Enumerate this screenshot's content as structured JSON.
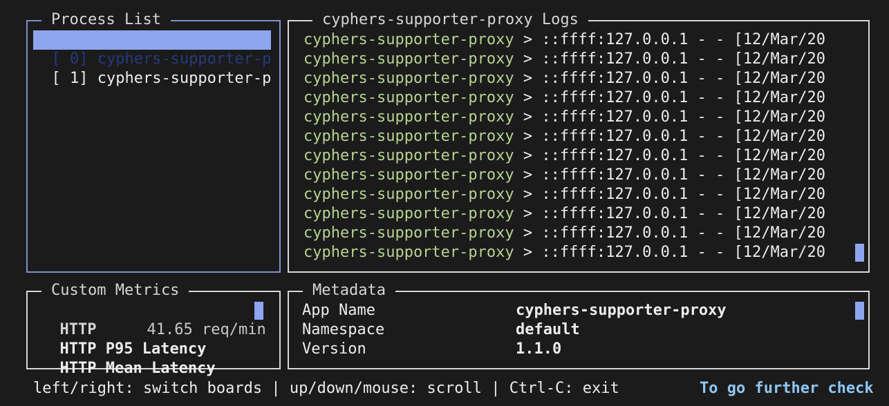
{
  "process_list": {
    "title": "Process List",
    "items": [
      {
        "label": "[ 0] cyphers-supporter-p",
        "selected": true
      },
      {
        "label": "[ 1] cyphers-supporter-p",
        "selected": false
      }
    ]
  },
  "logs": {
    "title": "cyphers-supporter-proxy Logs",
    "lines": [
      {
        "source": "cyphers-supporter-proxy",
        "message": " > ::ffff:127.0.0.1 - - [12/Mar/20"
      },
      {
        "source": "cyphers-supporter-proxy",
        "message": " > ::ffff:127.0.0.1 - - [12/Mar/20"
      },
      {
        "source": "cyphers-supporter-proxy",
        "message": " > ::ffff:127.0.0.1 - - [12/Mar/20"
      },
      {
        "source": "cyphers-supporter-proxy",
        "message": " > ::ffff:127.0.0.1 - - [12/Mar/20"
      },
      {
        "source": "cyphers-supporter-proxy",
        "message": " > ::ffff:127.0.0.1 - - [12/Mar/20"
      },
      {
        "source": "cyphers-supporter-proxy",
        "message": " > ::ffff:127.0.0.1 - - [12/Mar/20"
      },
      {
        "source": "cyphers-supporter-proxy",
        "message": " > ::ffff:127.0.0.1 - - [12/Mar/20"
      },
      {
        "source": "cyphers-supporter-proxy",
        "message": " > ::ffff:127.0.0.1 - - [12/Mar/20"
      },
      {
        "source": "cyphers-supporter-proxy",
        "message": " > ::ffff:127.0.0.1 - - [12/Mar/20"
      },
      {
        "source": "cyphers-supporter-proxy",
        "message": " > ::ffff:127.0.0.1 - - [12/Mar/20"
      },
      {
        "source": "cyphers-supporter-proxy",
        "message": " > ::ffff:127.0.0.1 - - [12/Mar/20"
      },
      {
        "source": "cyphers-supporter-proxy",
        "message": " > ::ffff:127.0.0.1 - - [12/Mar/20"
      }
    ]
  },
  "custom_metrics": {
    "title": "Custom Metrics",
    "rows": [
      {
        "name": "HTTP",
        "value": "41.65 req/min"
      },
      {
        "name": "HTTP P95 Latency",
        "value": ""
      },
      {
        "name": "HTTP Mean Latency",
        "value": ""
      }
    ]
  },
  "metadata": {
    "title": "Metadata",
    "rows": [
      {
        "key": "App Name",
        "value": "cyphers-supporter-proxy"
      },
      {
        "key": "Namespace",
        "value": "default"
      },
      {
        "key": "Version",
        "value": "1.1.0"
      }
    ]
  },
  "footer": {
    "help": "left/right: switch boards | up/down/mouse: scroll | Ctrl-C: exit",
    "further": "To go further check"
  },
  "colors": {
    "selection": "#8ea6ef",
    "log_source": "#b7d38f",
    "active_border": "#7d93c9",
    "link": "#8fc7f2"
  }
}
